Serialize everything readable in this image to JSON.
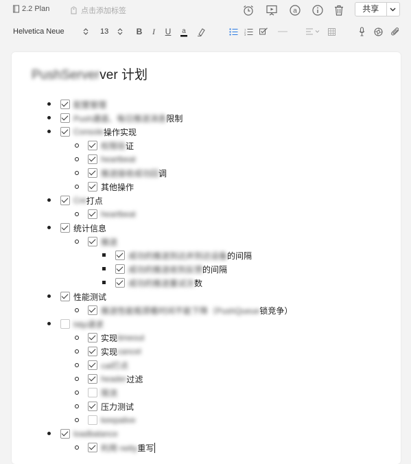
{
  "toolbar": {
    "notebook": "2.2 Plan",
    "add_tag_placeholder": "点击添加标签",
    "share_label": "共享"
  },
  "format": {
    "font_family": "Helvetica Neue",
    "font_size": "13"
  },
  "doc": {
    "title_blur": "PushServer",
    "title_rest": "ver 计划"
  },
  "items": [
    {
      "level": 1,
      "checked": true,
      "blur": "配置管理",
      "text": ""
    },
    {
      "level": 1,
      "checked": true,
      "blur": "Push通道、每日推送消息",
      "text": "限制"
    },
    {
      "level": 1,
      "checked": true,
      "blur": "Console",
      "text": " 操作实现"
    },
    {
      "level": 2,
      "checked": true,
      "blur": "权限验",
      "text": "证"
    },
    {
      "level": 2,
      "checked": true,
      "blur": "heartbeat",
      "text": ""
    },
    {
      "level": 2,
      "checked": true,
      "blur": "推送接收成功回",
      "text": "调"
    },
    {
      "level": 2,
      "checked": true,
      "blur": "",
      "text": "其他操作"
    },
    {
      "level": 1,
      "checked": true,
      "blur": "Cnt",
      "text": "打点"
    },
    {
      "level": 2,
      "checked": true,
      "blur": "heartbeat",
      "text": ""
    },
    {
      "level": 1,
      "checked": true,
      "blur": "",
      "text": "统计信息"
    },
    {
      "level": 2,
      "checked": true,
      "blur": "推送",
      "text": ""
    },
    {
      "level": 3,
      "checked": true,
      "blur": "成功的推送到达并到达设备",
      "text": "的间隔"
    },
    {
      "level": 3,
      "checked": true,
      "blur": "成功的推送收到反馈",
      "text": "的间隔"
    },
    {
      "level": 3,
      "checked": true,
      "blur": "成功的推送重试次",
      "text": "数"
    },
    {
      "level": 1,
      "checked": true,
      "blur": "",
      "text": "性能测试"
    },
    {
      "level": 2,
      "checked": true,
      "blur": "推送性能瓶颈看时间不能下降（PushQueue",
      "text": " 锁竞争）"
    },
    {
      "level": 1,
      "checked": false,
      "blur": "http请求",
      "text": ""
    },
    {
      "level": 2,
      "checked": true,
      "blur": "timeout",
      "text": "实现",
      "blur_after": true
    },
    {
      "level": 2,
      "checked": true,
      "blur": "cancel",
      "text": "实现",
      "blur_after": true
    },
    {
      "level": 2,
      "checked": true,
      "blur": "cat打点",
      "text": ""
    },
    {
      "level": 2,
      "checked": true,
      "blur": "header",
      "text": " 过滤"
    },
    {
      "level": 2,
      "checked": false,
      "blur": "限流",
      "text": ""
    },
    {
      "level": 2,
      "checked": true,
      "blur": "",
      "text": "压力测试"
    },
    {
      "level": 2,
      "checked": false,
      "blur": "keepalive",
      "text": ""
    },
    {
      "level": 1,
      "checked": true,
      "blur": "loadbalance",
      "text": ""
    },
    {
      "level": 2,
      "checked": true,
      "blur": "利用 netty",
      "text": " 重写",
      "caret": true
    }
  ]
}
